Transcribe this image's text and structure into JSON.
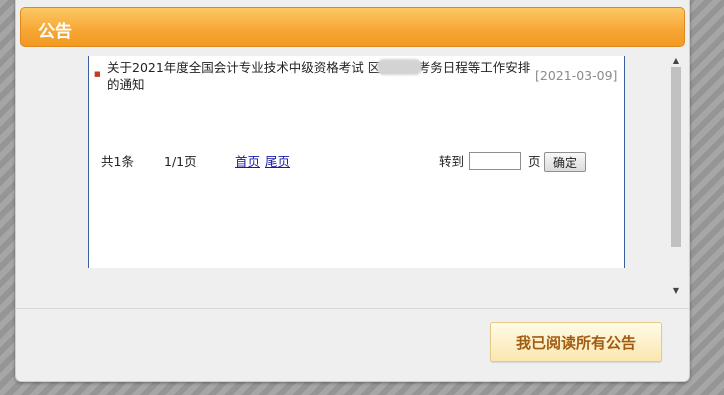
{
  "dialog": {
    "title": "公告",
    "notice": {
      "title": "关于2021年度全国会计专业技术中级资格考试 区报名及考务日程等工作安排的通知",
      "date": "[2021-03-09]"
    },
    "pager": {
      "total": "共1条",
      "page_info": "1/1页",
      "first": "首页",
      "last": "尾页",
      "goto_label": "转到",
      "page_unit": "页",
      "goto_value": "",
      "confirm_label": "确定"
    },
    "read_all_button": "我已阅读所有公告"
  },
  "colors": {
    "header_orange": "#f6a634",
    "link_blue": "#1a1aa6",
    "button_text": "#a15c11"
  }
}
